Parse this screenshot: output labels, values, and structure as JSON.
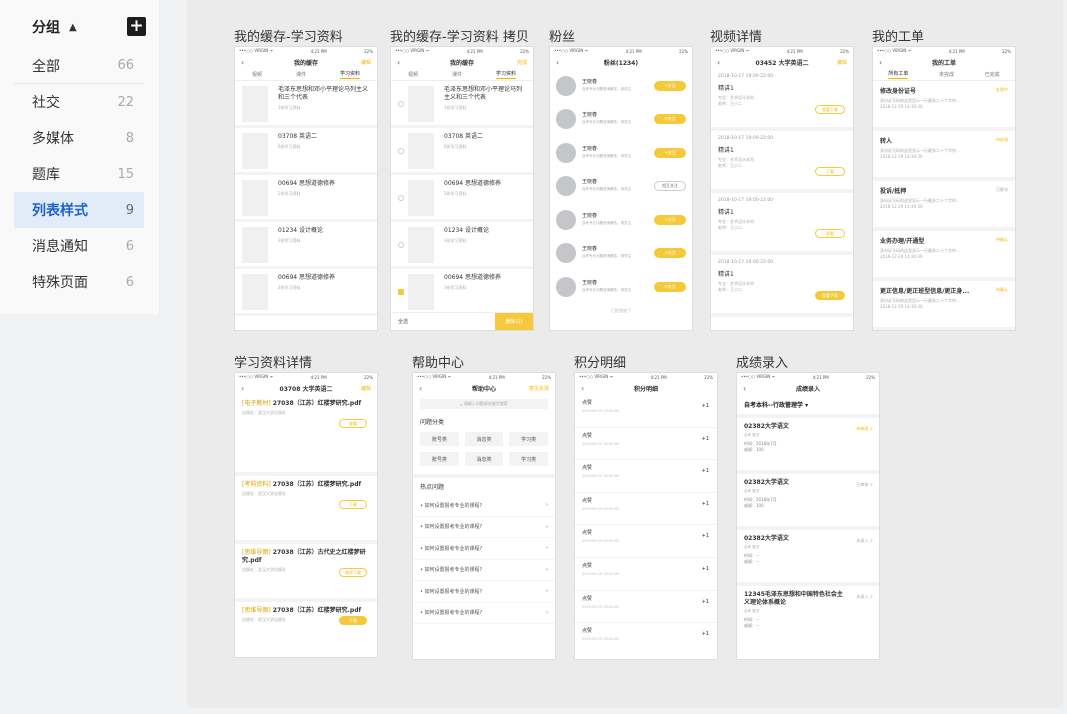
{
  "sidebar": {
    "group_title": "分组",
    "items": [
      {
        "label": "全部",
        "count": "66"
      },
      {
        "label": "社交",
        "count": "22"
      },
      {
        "label": "多媒体",
        "count": "8"
      },
      {
        "label": "题库",
        "count": "15"
      },
      {
        "label": "列表样式",
        "count": "9"
      },
      {
        "label": "消息通知",
        "count": "6"
      },
      {
        "label": "特殊页面",
        "count": "6"
      }
    ]
  },
  "status": {
    "carrier": "•••○○ VIRGIN ᯤ",
    "time": "4:21 PM",
    "battery": "22%"
  },
  "cards": {
    "c1": {
      "title": "我的缓存-学习资料",
      "nav": "我的缓存",
      "action": "编辑",
      "tabs": [
        "视频",
        "课件",
        "学习资料"
      ],
      "rows": [
        {
          "t": "毛泽东思想和邓小平理论马列主义和三个代表",
          "s": "3份学习资料"
        },
        {
          "t": "03708 英语二",
          "s": "6份学习资料"
        },
        {
          "t": "00694 思想道德修养",
          "s": "2份学习资料"
        },
        {
          "t": "01234 设计概论",
          "s": "3份学习资料"
        },
        {
          "t": "00694 思想道德修养",
          "s": "2份学习资料"
        }
      ]
    },
    "c2": {
      "title": "我的缓存-学习资料 拷贝",
      "nav": "我的缓存",
      "action": "完成",
      "tabs": [
        "视频",
        "课件",
        "学习资料"
      ],
      "rows": [
        {
          "t": "毛泽东思想和邓小平理论马列主义和三个代表",
          "s": "3份学习资料"
        },
        {
          "t": "03708 英语二",
          "s": "6份学习资料"
        },
        {
          "t": "00694 思想道德修养",
          "s": "2份学习资料"
        },
        {
          "t": "01234 设计概论",
          "s": "3份学习资料"
        },
        {
          "t": "00694 思想道德修养",
          "s": "3份学习资料"
        }
      ],
      "select_all": "全选",
      "delete": "删除(1)"
    },
    "c3": {
      "title": "粉丝",
      "nav": "粉丝(1234)",
      "name": "王晓春",
      "desc": "自考专业问题咨询解答，请关注",
      "follow": "+关注",
      "mutual": "相互关注",
      "more": "已经到底了"
    },
    "c4": {
      "title": "视频详情",
      "nav": "03452 大学英语二",
      "action": "编辑",
      "items": [
        {
          "d": "2018-10-17 19:00-22:00",
          "t": "精讲1",
          "m1": "专业：艺术设计本科",
          "m2": "老师：王小二",
          "b": "观看下载"
        },
        {
          "d": "2018-10-17 19:00-22:00",
          "t": "精讲1",
          "m1": "专业：艺术设计本科",
          "m2": "老师：王小二",
          "b": "下载"
        },
        {
          "d": "2018-10-17 19:00-22:00",
          "t": "精讲1",
          "m1": "专业：艺术设计本科",
          "m2": "老师：王小二",
          "b": "观看"
        },
        {
          "d": "2018-10-17 19:00-22:00",
          "t": "精讲1",
          "m1": "专业：艺术设计本科",
          "m2": "老师：王小二",
          "b": "观看下载"
        }
      ]
    },
    "c5": {
      "title": "我的工单",
      "nav": "我的工单",
      "tabs": [
        "所有工单",
        "未完成",
        "已完成"
      ],
      "items": [
        {
          "t": "修改身份证号",
          "st": "处理中",
          "m": "身份证号码的这里显示一行最多二十个字符...",
          "d": "2018-12-29 14:30:30"
        },
        {
          "t": "转人",
          "st": "待处理",
          "m": "身份证号码的这里显示一行最多二十个字符...",
          "d": "2018-12-29 14:30:30"
        },
        {
          "t": "投诉/抵押",
          "st": "已解决",
          "m": "身份证号码的这里显示一行最多二十个字符...",
          "d": "2018-12-29 14:30:30"
        },
        {
          "t": "业务办理/开通型",
          "st": "待确认",
          "m": "身份证号码的这里显示一行最多二十个字符...",
          "d": "2018-12-29 14:30:30"
        },
        {
          "t": "更正信息/更正班型信息/更正身...",
          "st": "待确认",
          "m": "身份证号码的这里显示一行最多二十个字符...",
          "d": "2018-12-29 14:30:30"
        }
      ]
    },
    "c6": {
      "title": "学习资料详情",
      "nav": "03708 大学英语二",
      "action": "编辑",
      "items": [
        {
          "tag": "[电子教材]",
          "t": "27038（江苏）红楼梦研究.pdf",
          "m": "出版社：武汉大学出版社",
          "b": "查看"
        },
        {
          "tag": "[考前资料]",
          "t": "27038（江苏）红楼梦研究.pdf",
          "m": "出版社：武汉大学出版社",
          "b": "下载"
        },
        {
          "tag": "[思维导图]",
          "t": "27038（江苏）古代史之红楼梦研究.pdf",
          "m": "出版社：武汉大学出版社",
          "b": "继续下载"
        },
        {
          "tag": "[思维导图]",
          "t": "27038（江苏）红楼梦研究.pdf",
          "m": "出版社：武汉大学出版社",
          "b": "下载"
        }
      ]
    },
    "c7": {
      "title": "帮助中心",
      "nav": "帮助中心",
      "action": "意见反馈",
      "search": "请输入问题或关键字搜索",
      "cat_title": "问题分类",
      "cats": [
        "账号类",
        "消息类",
        "学习类",
        "账号类",
        "消息类",
        "学习类"
      ],
      "hot_title": "热点问题",
      "q": "如何设置报考专业的课程?"
    },
    "c8": {
      "title": "积分明细",
      "nav": "积分明细",
      "item": "点赞",
      "date": "2019-09-15 10:00:00",
      "val": "+1"
    },
    "c9": {
      "title": "成绩录入",
      "nav": "成绩录入",
      "header": "自考本科--行政管理学 ▾",
      "items": [
        {
          "t": "02382大学语文",
          "tg": "必考  笔试",
          "m1": "时间：2018年7月",
          "m2": "成绩：100",
          "st": "待修改 >",
          "g": false
        },
        {
          "t": "02382大学语文",
          "tg": "必考  笔试",
          "m1": "时间：2018年7月",
          "m2": "成绩：100",
          "st": "已审核 >",
          "g": true
        },
        {
          "t": "02382大学语文",
          "tg": "必考  笔试",
          "m1": "时间：--",
          "m2": "成绩：--",
          "st": "未录入 >",
          "g": true
        },
        {
          "t": "12345毛泽东思想和中国特色社会主义理论体系概论",
          "tg": "必考  笔试",
          "m1": "时间：--",
          "m2": "成绩：--",
          "st": "未录入 >",
          "g": true
        }
      ]
    }
  }
}
